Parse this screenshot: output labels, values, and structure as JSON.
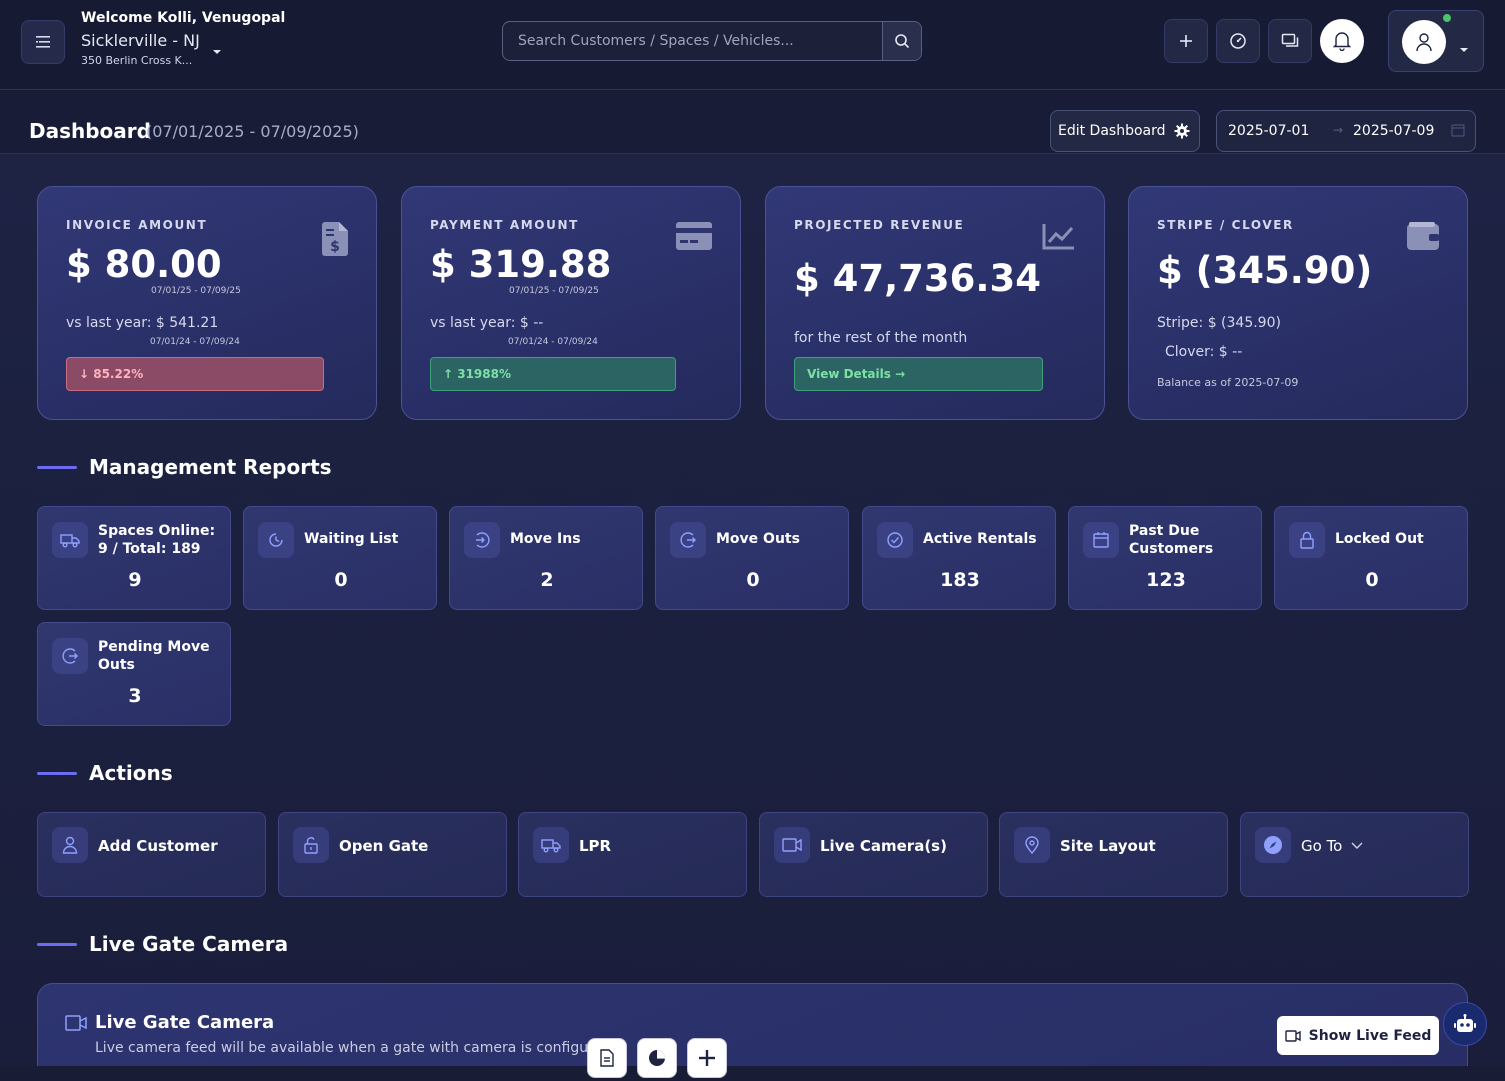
{
  "header": {
    "welcome": "Welcome Kolli, Venugopal",
    "site_name": "Sicklerville - NJ",
    "site_address": "350 Berlin Cross K...",
    "search_placeholder": "Search Customers / Spaces / Vehicles..."
  },
  "dashboard": {
    "title": "Dashboard",
    "range": "(07/01/2025 - 07/09/2025)",
    "edit_label": "Edit Dashboard",
    "date_start": "2025-07-01",
    "date_arrow": "→",
    "date_end": "2025-07-09"
  },
  "kpis": {
    "invoice": {
      "label": "INVOICE AMOUNT",
      "amount": "$ 80.00",
      "period": "07/01/25 - 07/09/25",
      "vs": "vs last year: $ 541.21",
      "vs_period": "07/01/24 - 07/09/24",
      "change": "↓ 85.22%"
    },
    "payment": {
      "label": "PAYMENT AMOUNT",
      "amount": "$ 319.88",
      "period": "07/01/25 - 07/09/25",
      "vs": "vs last year: $ --",
      "vs_period": "07/01/24 - 07/09/24",
      "change": "↑ 31988%"
    },
    "projected": {
      "label": "PROJECTED REVENUE",
      "amount": "$ 47,736.34",
      "note": "for the rest of the month",
      "link": "View Details →"
    },
    "stripe": {
      "label": "STRIPE / CLOVER",
      "amount": "$ (345.90)",
      "stripe": "Stripe: $ (345.90)",
      "clover": "Clover: $ --",
      "balance": "Balance as of 2025-07-09"
    }
  },
  "management": {
    "title": "Management Reports",
    "items": [
      {
        "label": "Spaces Online: 9 / Total: 189",
        "value": "9",
        "icon": "truck-icon"
      },
      {
        "label": "Waiting List",
        "value": "0",
        "icon": "clock-icon"
      },
      {
        "label": "Move Ins",
        "value": "2",
        "icon": "move-in-icon"
      },
      {
        "label": "Move Outs",
        "value": "0",
        "icon": "move-out-icon"
      },
      {
        "label": "Active Rentals",
        "value": "183",
        "icon": "check-circle-icon"
      },
      {
        "label": "Past Due Customers",
        "value": "123",
        "icon": "calendar-icon"
      },
      {
        "label": "Locked Out",
        "value": "0",
        "icon": "lock-icon"
      },
      {
        "label": "Pending Move Outs",
        "value": "3",
        "icon": "move-out-icon"
      }
    ]
  },
  "actions": {
    "title": "Actions",
    "items": [
      {
        "label": "Add Customer",
        "icon": "user-icon"
      },
      {
        "label": "Open Gate",
        "icon": "unlock-icon"
      },
      {
        "label": "LPR",
        "icon": "truck-icon"
      },
      {
        "label": "Live Camera(s)",
        "icon": "video-icon"
      },
      {
        "label": "Site Layout",
        "icon": "map-pin-icon"
      },
      {
        "label": "Go To",
        "icon": "compass-icon"
      }
    ]
  },
  "camera": {
    "section_title": "Live Gate Camera",
    "card_title": "Live Gate Camera",
    "description": "Live camera feed will be available when a gate with camera is configured",
    "show_feed": "Show Live Feed"
  }
}
